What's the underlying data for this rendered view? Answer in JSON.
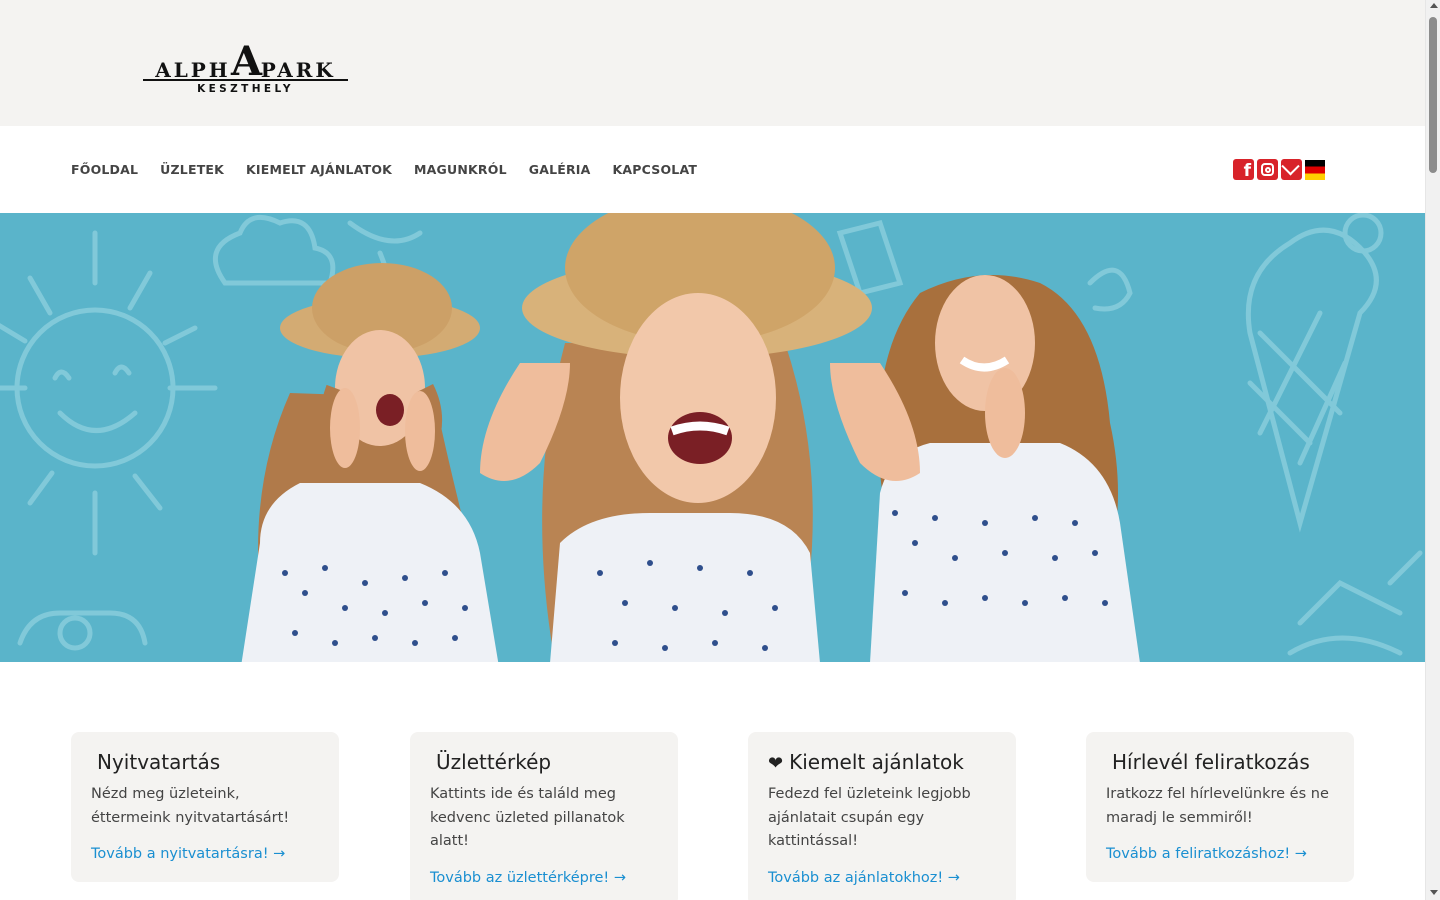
{
  "header": {
    "logo": {
      "word": "ALPHAPARK",
      "big_letter": "A",
      "left": "ALPH",
      "right": "PARK",
      "sub": "KESZTHELY"
    }
  },
  "nav": {
    "items": [
      "FŐOLDAL",
      "ÜZLETEK",
      "KIEMELT AJÁNLATOK",
      "MAGUNKRÓL",
      "GALÉRIA",
      "KAPCSOLAT"
    ],
    "social": [
      "facebook-icon",
      "instagram-icon",
      "mail-icon",
      "german-flag-icon"
    ]
  },
  "colors": {
    "accent": "#d8232a",
    "link": "#1a8fd1",
    "hero_bg": "#5ab4ca",
    "card_bg": "#f4f3f1"
  },
  "cards": [
    {
      "icon": "clock-icon",
      "glyph": "",
      "title": "Nyitvatartás",
      "text": "Nézd meg üzleteink, éttermeink nyitvatartásárt!",
      "link": "Tovább a nyitvatartásra! →"
    },
    {
      "icon": "map-icon",
      "glyph": "",
      "title": "Üzlettérkép",
      "text": "Kattints ide és találd meg kedvenc üzleted pillanatok alatt!",
      "link": "Tovább az üzlettérképre! →"
    },
    {
      "icon": "heart-icon",
      "glyph": "❤",
      "title": "Kiemelt ajánlatok",
      "text": "Fedezd fel üzleteink legjobb ajánlatait csupán egy kattintással!",
      "link": "Tovább az ajánlatokhoz! →"
    },
    {
      "icon": "envelope-icon",
      "glyph": "",
      "title": "Hírlevél feliratkozás",
      "text": "Iratkozz fel hírlevelünkre és ne maradj le semmiről!",
      "link": "Tovább a feliratkozáshoz! →"
    }
  ]
}
